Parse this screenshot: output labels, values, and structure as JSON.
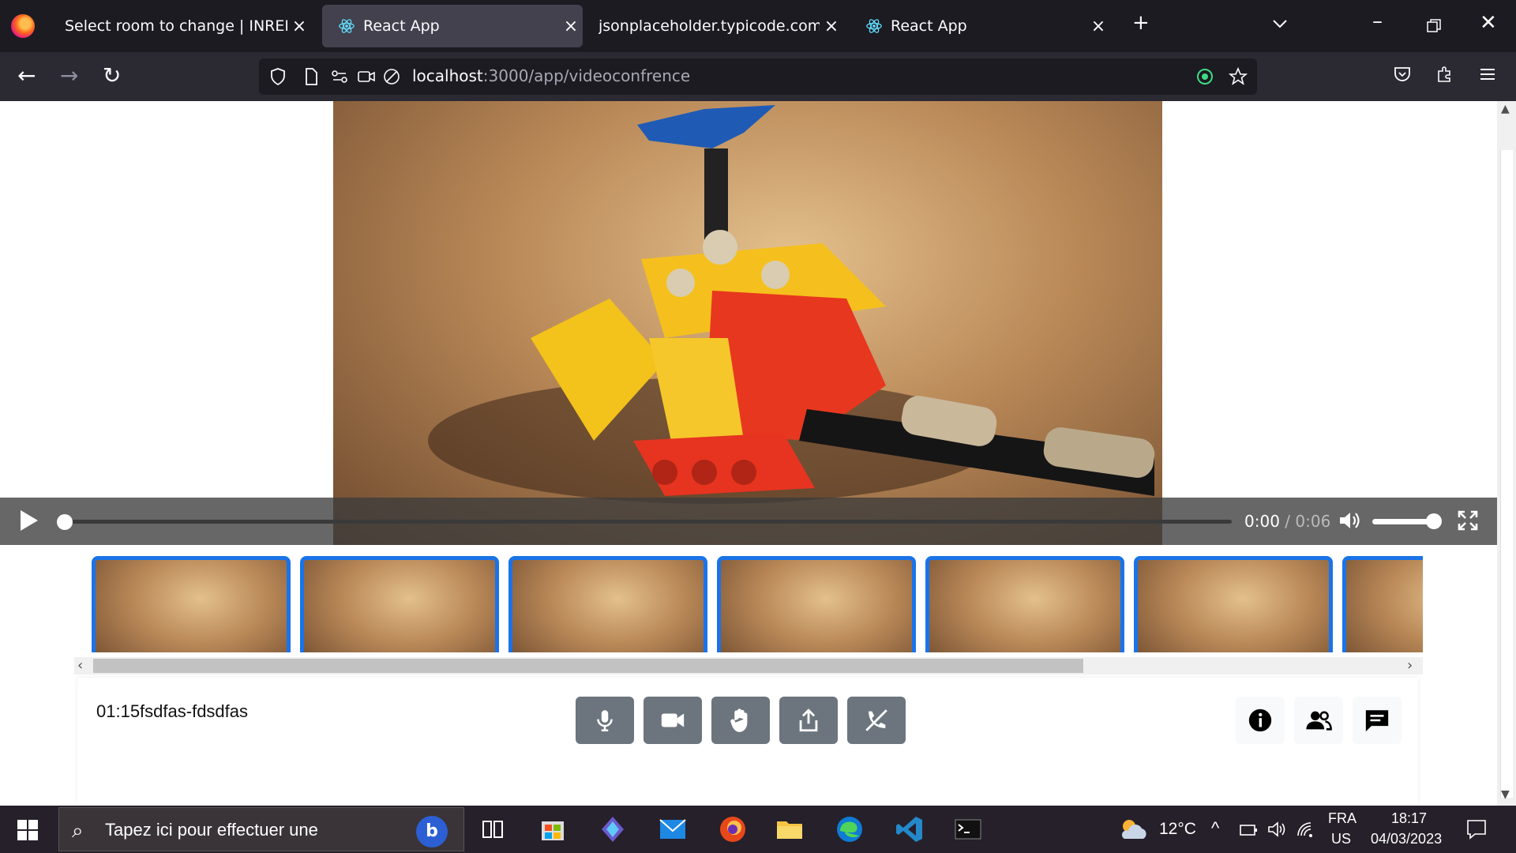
{
  "browser": {
    "tabs": [
      {
        "label": "Select room to change | INREPM Ad",
        "active": false,
        "has_react_icon": false
      },
      {
        "label": "React App",
        "active": true,
        "has_react_icon": true
      },
      {
        "label": "jsonplaceholder.typicode.com/posts",
        "active": false,
        "has_react_icon": false
      },
      {
        "label": "React App",
        "active": false,
        "has_react_icon": true
      }
    ],
    "url_host": "localhost",
    "url_path": ":3000/app/videoconfrence"
  },
  "video": {
    "current_time": "0:00",
    "separator": " / ",
    "duration": "0:06",
    "progress": 0,
    "volume": 1
  },
  "thumbnails": {
    "count": 7,
    "highlight_color": "#1a73e8"
  },
  "meeting": {
    "id_text": "01:15fsdfas-fdsdfas",
    "controls": [
      "mic-icon",
      "camera-icon",
      "raise-hand-icon",
      "share-screen-icon",
      "end-call-icon"
    ],
    "right_controls": [
      "info-icon",
      "participants-icon",
      "chat-icon"
    ],
    "button_color": "#6c757d"
  },
  "taskbar": {
    "search_placeholder": "Tapez ici pour effectuer une",
    "weather": "12°C",
    "lang_top": "FRA",
    "lang_bottom": "US",
    "time": "18:17",
    "date": "04/03/2023"
  }
}
